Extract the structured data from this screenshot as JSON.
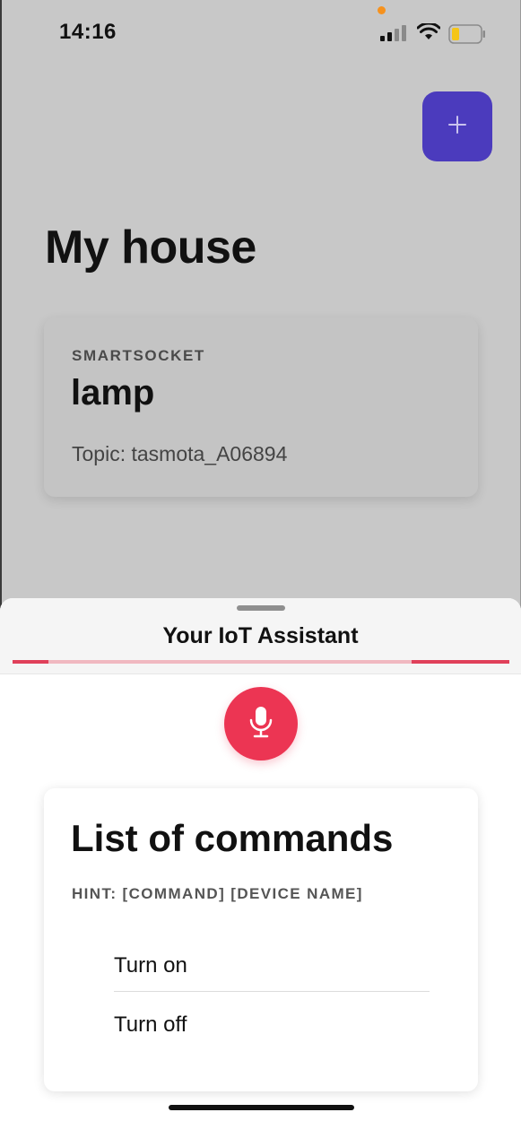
{
  "status_bar": {
    "time": "14:16",
    "icons": [
      "signal-icon",
      "wifi-icon",
      "battery-icon"
    ],
    "battery_color": "#f5c518",
    "indicator_dot_color": "#f6921e"
  },
  "header": {
    "add_button_icon": "plus-icon",
    "add_button_color": "#4b3bbd"
  },
  "page": {
    "title": "My house"
  },
  "devices": [
    {
      "type": "SMARTSOCKET",
      "name": "lamp",
      "topic": "Topic: tasmota_A06894"
    }
  ],
  "assistant": {
    "title": "Your IoT Assistant",
    "mic_icon": "microphone-icon",
    "accent_color": "#ec3553",
    "commands_title": "List of commands",
    "hint": "HINT: [COMMAND] [DEVICE NAME]",
    "commands": [
      "Turn on",
      "Turn off"
    ]
  }
}
